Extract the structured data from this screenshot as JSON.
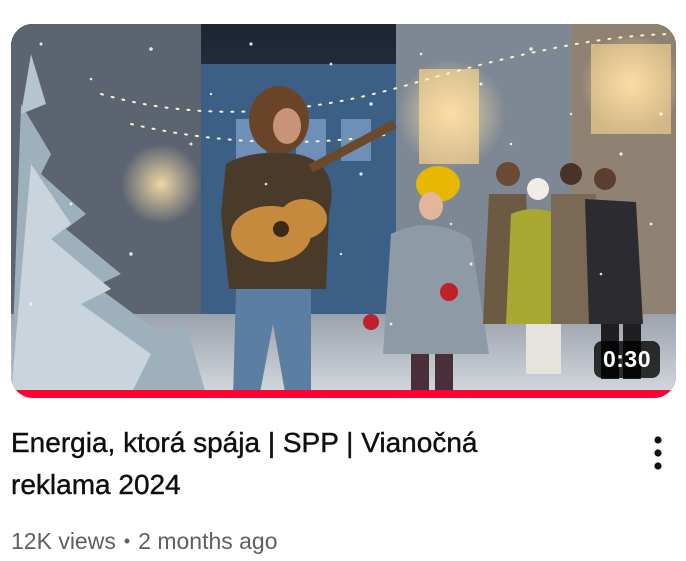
{
  "video": {
    "duration": "0:30",
    "watch_progress": 1.0,
    "title": "Energia, ktorá spája | SPP | Vianočná reklama 2024",
    "views": "12K views",
    "separator": "•",
    "age": "2 months ago"
  },
  "colors": {
    "progress": "#ff0033",
    "title": "#0f0f0f",
    "meta": "#606060"
  },
  "icons": {
    "menu": "more-vert-icon"
  }
}
